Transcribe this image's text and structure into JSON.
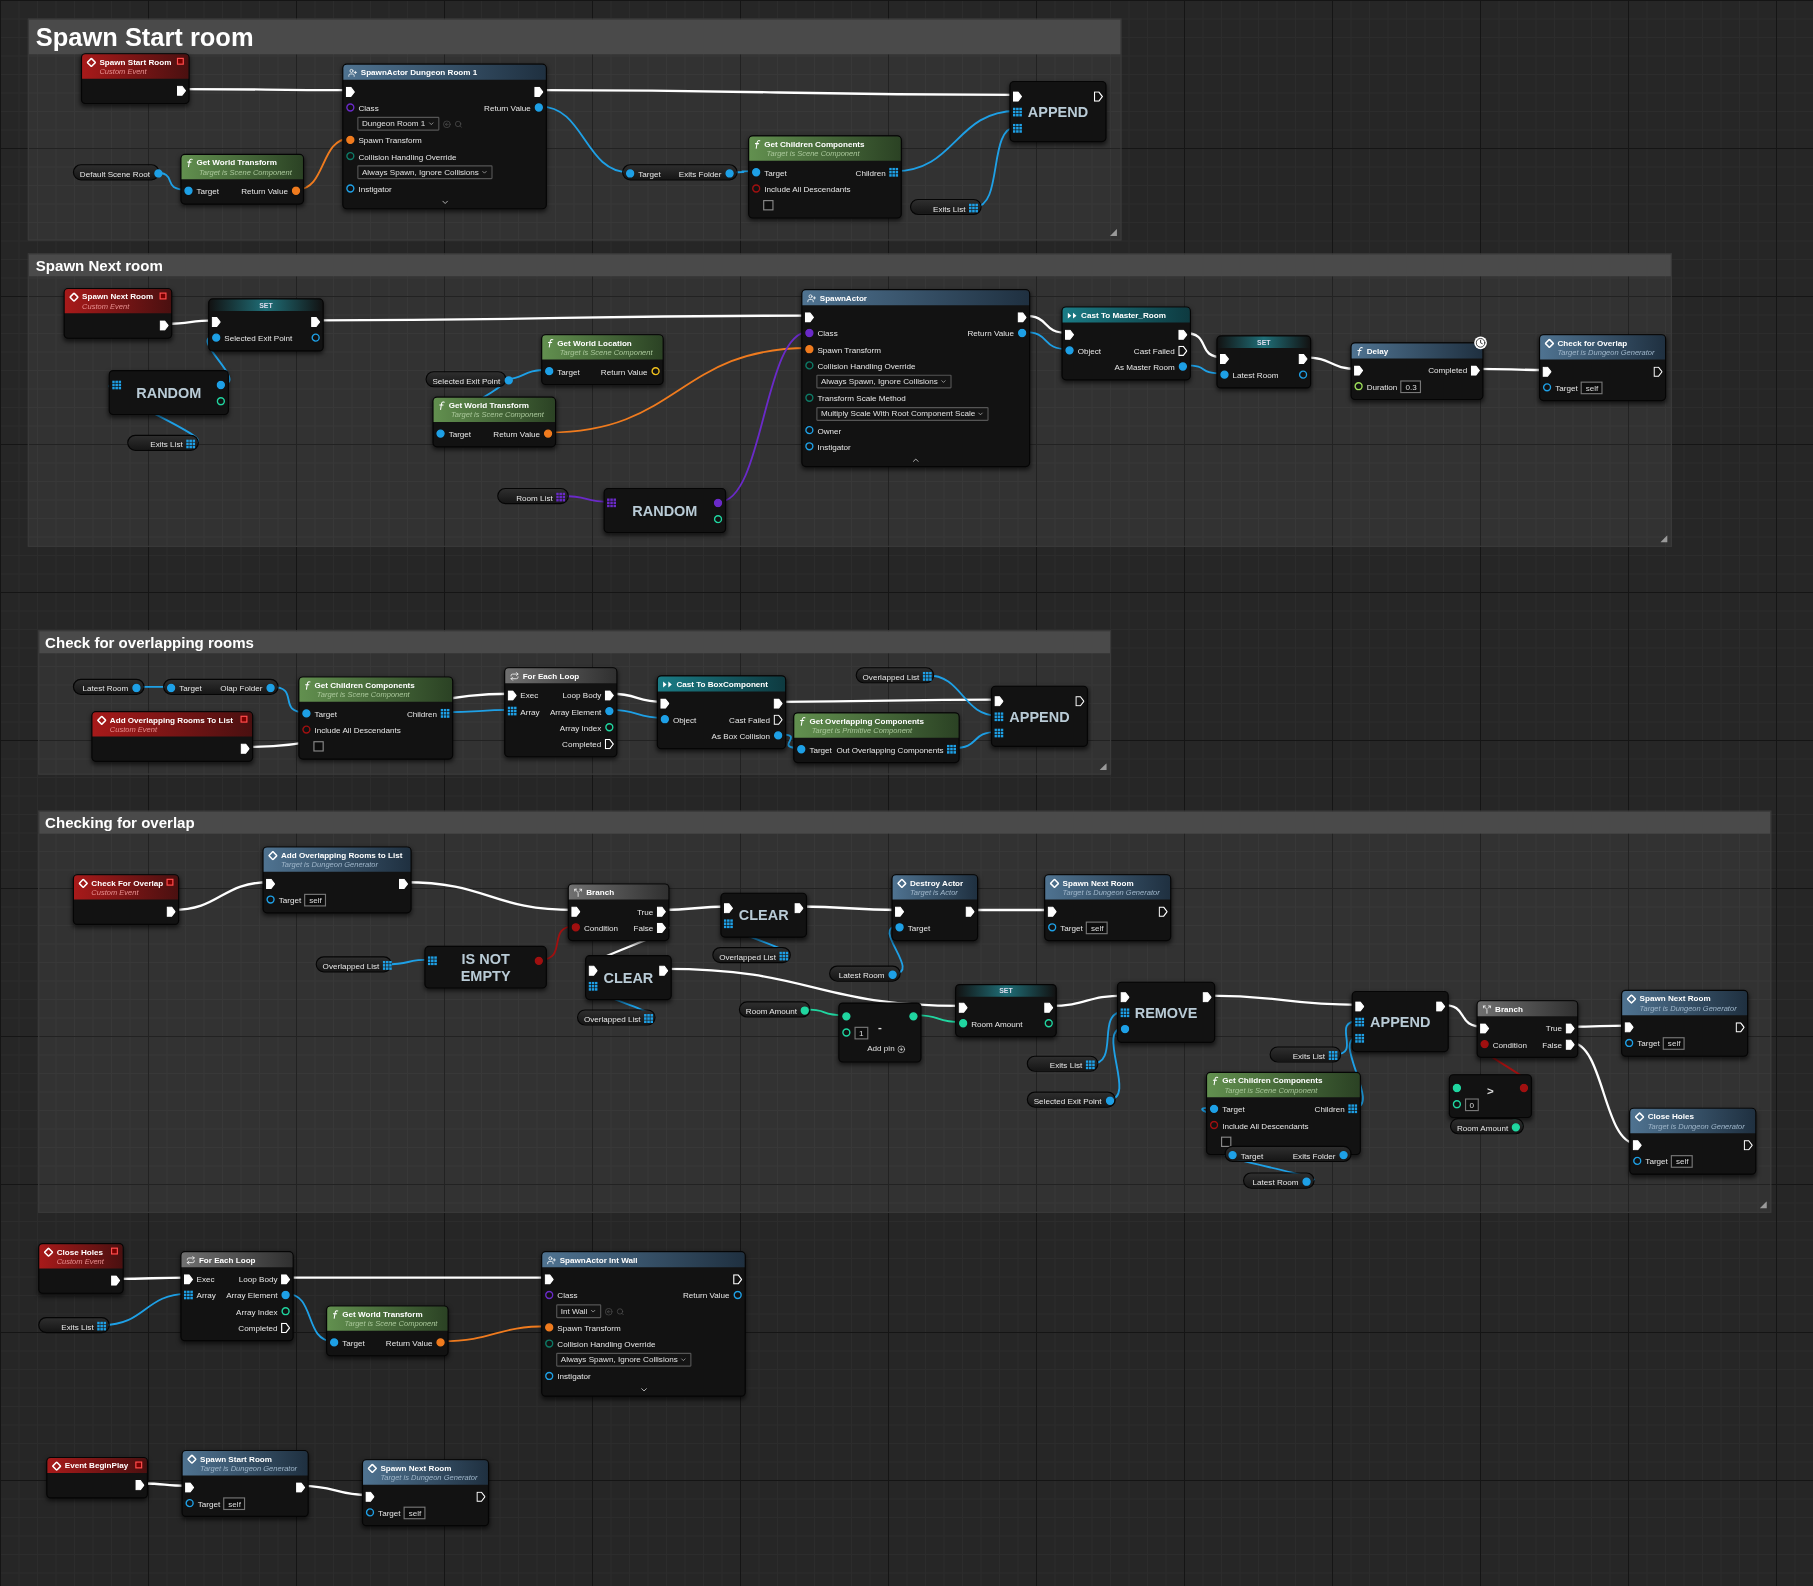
{
  "comments": [
    {
      "title": "Spawn Start room",
      "nodes": [
        {
          "kind": "event",
          "title": "Spawn Start Room",
          "subtitle": "Custom Event",
          "rows": [
            {
              "out": {
                "kind": "exec",
                "linked": true
              }
            }
          ]
        },
        {
          "kind": "spawn",
          "title": "SpawnActor Dungeon Room 1",
          "expanded": false,
          "rows": [
            {
              "in": {
                "kind": "exec",
                "linked": true
              },
              "out": {
                "kind": "exec",
                "linked": true
              }
            },
            {
              "in": {
                "kind": "class",
                "label": "Class",
                "linked": false
              },
              "out": {
                "kind": "object",
                "label": "Return Value",
                "linked": true
              }
            },
            {
              "dropdown": {
                "kind": "class",
                "text": "Dungeon Room 1"
              }
            },
            {
              "in": {
                "kind": "transform",
                "label": "Spawn Transform",
                "linked": true
              }
            },
            {
              "in": {
                "kind": "enum",
                "label": "Collision Handling Override",
                "linked": false
              }
            },
            {
              "dropdown": {
                "kind": "enum",
                "text": "Always Spawn, Ignore Collisions"
              }
            },
            {
              "in": {
                "kind": "object",
                "label": "Instigator",
                "linked": false
              }
            }
          ]
        },
        {
          "kind": "variable",
          "rows": [
            {
              "out": {
                "kind": "object",
                "label": "Default Scene Root",
                "linked": true
              }
            }
          ]
        },
        {
          "kind": "pure",
          "title": "Get World Transform",
          "subtitle": "Target is Scene Component",
          "rows": [
            {
              "in": {
                "kind": "object",
                "label": "Target",
                "linked": true
              },
              "out": {
                "kind": "transform",
                "label": "Return Value",
                "linked": true
              }
            }
          ]
        },
        {
          "kind": "getter",
          "rows": [
            {
              "in": {
                "kind": "object",
                "label": "Target",
                "linked": true
              },
              "out": {
                "kind": "object",
                "label": "Exits Folder",
                "linked": true
              }
            }
          ]
        },
        {
          "kind": "pure",
          "title": "Get Children Components",
          "subtitle": "Target is Scene Component",
          "rows": [
            {
              "in": {
                "kind": "object",
                "label": "Target",
                "linked": true
              },
              "out": {
                "kind": "object_array",
                "label": "Children",
                "linked": true
              }
            },
            {
              "in": {
                "kind": "bool",
                "label": "Include All Descendants",
                "linked": false
              }
            },
            {
              "checkbox": {
                "checked": false
              }
            }
          ]
        },
        {
          "kind": "variable",
          "rows": [
            {
              "out": {
                "kind": "object_array",
                "label": "Exits List",
                "linked": true
              }
            }
          ]
        },
        {
          "kind": "macro",
          "title": "APPEND",
          "rows": [
            {
              "in": {
                "kind": "exec",
                "linked": true
              },
              "out": {
                "kind": "exec",
                "linked": false
              }
            },
            {
              "in": {
                "kind": "object_array",
                "linked": true
              }
            },
            {
              "in": {
                "kind": "object_array",
                "linked": true
              }
            }
          ]
        }
      ]
    },
    {
      "title": "Spawn Next room",
      "nodes": [
        {
          "kind": "event",
          "title": "Spawn Next Room",
          "subtitle": "Custom Event",
          "rows": [
            {
              "out": {
                "kind": "exec",
                "linked": true
              }
            }
          ]
        },
        {
          "kind": "set",
          "title": "SET",
          "rows": [
            {
              "in": {
                "kind": "exec",
                "linked": true
              },
              "out": {
                "kind": "exec",
                "linked": true
              }
            },
            {
              "in": {
                "kind": "object",
                "label": "Selected Exit Point",
                "linked": true
              },
              "out": {
                "kind": "object",
                "linked": false
              }
            }
          ]
        },
        {
          "kind": "macro",
          "title": "RANDOM",
          "rows": [
            {
              "in": {
                "kind": "object_array",
                "linked": true
              },
              "out": {
                "kind": "object",
                "linked": true
              }
            },
            {
              "out": {
                "kind": "int",
                "linked": false
              }
            }
          ]
        },
        {
          "kind": "variable",
          "rows": [
            {
              "out": {
                "kind": "object_array",
                "label": "Exits List",
                "linked": true
              }
            }
          ]
        },
        {
          "kind": "pure",
          "title": "Get World Location",
          "subtitle": "Target is Scene Component",
          "rows": [
            {
              "in": {
                "kind": "object",
                "label": "Target",
                "linked": true
              },
              "out": {
                "kind": "vector",
                "label": "Return Value",
                "linked": false
              }
            }
          ]
        },
        {
          "kind": "variable",
          "rows": [
            {
              "out": {
                "kind": "object",
                "label": "Selected Exit Point",
                "linked": true
              }
            }
          ]
        },
        {
          "kind": "pure",
          "title": "Get World Transform",
          "subtitle": "Target is Scene Component",
          "rows": [
            {
              "in": {
                "kind": "object",
                "label": "Target",
                "linked": true
              },
              "out": {
                "kind": "transform",
                "label": "Return Value",
                "linked": true
              }
            }
          ]
        },
        {
          "kind": "variable",
          "rows": [
            {
              "out": {
                "kind": "class_array",
                "label": "Room List",
                "linked": true
              }
            }
          ]
        },
        {
          "kind": "macro",
          "title": "RANDOM",
          "rows": [
            {
              "in": {
                "kind": "class_array",
                "linked": true
              },
              "out": {
                "kind": "class",
                "linked": true
              }
            },
            {
              "out": {
                "kind": "int",
                "linked": false
              }
            }
          ]
        },
        {
          "kind": "spawn",
          "title": "SpawnActor",
          "expanded": true,
          "rows": [
            {
              "in": {
                "kind": "exec",
                "linked": true
              },
              "out": {
                "kind": "exec",
                "linked": true
              }
            },
            {
              "in": {
                "kind": "class",
                "label": "Class",
                "linked": true
              },
              "out": {
                "kind": "object",
                "label": "Return Value",
                "linked": true
              }
            },
            {
              "in": {
                "kind": "transform",
                "label": "Spawn Transform",
                "linked": true
              }
            },
            {
              "in": {
                "kind": "enum",
                "label": "Collision Handling Override",
                "linked": false
              }
            },
            {
              "dropdown": {
                "kind": "enum",
                "text": "Always Spawn, Ignore Collisions"
              }
            },
            {
              "in": {
                "kind": "enum",
                "label": "Transform Scale Method",
                "linked": false
              }
            },
            {
              "dropdown": {
                "kind": "enum",
                "text": "Multiply Scale With Root Component Scale"
              }
            },
            {
              "in": {
                "kind": "object",
                "label": "Owner",
                "linked": false
              }
            },
            {
              "in": {
                "kind": "object",
                "label": "Instigator",
                "linked": false
              }
            }
          ]
        },
        {
          "kind": "cast",
          "title": "Cast To Master_Room",
          "rows": [
            {
              "in": {
                "kind": "exec",
                "linked": true
              },
              "out": {
                "kind": "exec",
                "linked": true
              }
            },
            {
              "in": {
                "kind": "object",
                "label": "Object",
                "linked": true
              },
              "out": {
                "kind": "exec",
                "label": "Cast Failed",
                "linked": false
              }
            },
            {
              "out": {
                "kind": "object",
                "label": "As Master Room",
                "linked": true
              }
            }
          ]
        },
        {
          "kind": "set",
          "title": "SET",
          "rows": [
            {
              "in": {
                "kind": "exec",
                "linked": true
              },
              "out": {
                "kind": "exec",
                "linked": true
              }
            },
            {
              "in": {
                "kind": "object",
                "label": "Latest Room",
                "linked": true
              },
              "out": {
                "kind": "object",
                "linked": false
              }
            }
          ]
        },
        {
          "kind": "latent",
          "title": "Delay",
          "rows": [
            {
              "in": {
                "kind": "exec",
                "linked": true
              },
              "out": {
                "kind": "exec",
                "label": "Completed",
                "linked": true
              }
            },
            {
              "in": {
                "kind": "float",
                "label": "Duration",
                "linked": false
              },
              "value": "0.3"
            }
          ]
        },
        {
          "kind": "call",
          "title": "Check for Overlap",
          "subtitle": "Target is Dungeon Generator",
          "rows": [
            {
              "in": {
                "kind": "exec",
                "linked": true
              },
              "out": {
                "kind": "exec",
                "linked": false
              }
            },
            {
              "in": {
                "kind": "object",
                "label": "Target",
                "linked": false
              },
              "value": "self"
            }
          ]
        }
      ]
    },
    {
      "title": "Check for overlapping rooms",
      "nodes": [
        {
          "kind": "variable",
          "rows": [
            {
              "out": {
                "kind": "object",
                "label": "Latest Room",
                "linked": true
              }
            }
          ]
        },
        {
          "kind": "getter",
          "rows": [
            {
              "in": {
                "kind": "object",
                "label": "Target",
                "linked": true
              },
              "out": {
                "kind": "object",
                "label": "Olap Folder",
                "linked": true
              }
            }
          ]
        },
        {
          "kind": "event",
          "title": "Add Overlapping Rooms To List",
          "subtitle": "Custom Event",
          "rows": [
            {
              "out": {
                "kind": "exec",
                "linked": true
              }
            }
          ]
        },
        {
          "kind": "pure",
          "title": "Get Children Components",
          "subtitle": "Target is Scene Component",
          "rows": [
            {
              "in": {
                "kind": "object",
                "label": "Target",
                "linked": true
              },
              "out": {
                "kind": "object_array",
                "label": "Children",
                "linked": true
              }
            },
            {
              "in": {
                "kind": "bool",
                "label": "Include All Descendants",
                "linked": false
              }
            },
            {
              "checkbox": {
                "checked": false
              }
            }
          ]
        },
        {
          "kind": "loop",
          "title": "For Each Loop",
          "rows": [
            {
              "in": {
                "kind": "exec",
                "label": "Exec",
                "linked": true
              },
              "out": {
                "kind": "exec",
                "label": "Loop Body",
                "linked": true
              }
            },
            {
              "in": {
                "kind": "object_array",
                "label": "Array",
                "linked": true
              },
              "out": {
                "kind": "object",
                "label": "Array Element",
                "linked": true
              }
            },
            {
              "out": {
                "kind": "int",
                "label": "Array Index",
                "linked": false
              }
            },
            {
              "out": {
                "kind": "exec",
                "label": "Completed",
                "linked": false
              }
            }
          ]
        },
        {
          "kind": "cast",
          "title": "Cast To BoxComponent",
          "rows": [
            {
              "in": {
                "kind": "exec",
                "linked": true
              },
              "out": {
                "kind": "exec",
                "linked": true
              }
            },
            {
              "in": {
                "kind": "object",
                "label": "Object",
                "linked": true
              },
              "out": {
                "kind": "exec",
                "label": "Cast Failed",
                "linked": false
              }
            },
            {
              "out": {
                "kind": "object",
                "label": "As Box Collision",
                "linked": true
              }
            }
          ]
        },
        {
          "kind": "variable",
          "rows": [
            {
              "out": {
                "kind": "object_array",
                "label": "Overlapped List",
                "linked": true
              }
            }
          ]
        },
        {
          "kind": "pure",
          "title": "Get Overlapping Components",
          "subtitle": "Target is Primitive Component",
          "rows": [
            {
              "in": {
                "kind": "object",
                "label": "Target",
                "linked": true
              },
              "out": {
                "kind": "object_array",
                "label": "Out Overlapping Components",
                "linked": true
              }
            }
          ]
        },
        {
          "kind": "macro",
          "title": "APPEND",
          "rows": [
            {
              "in": {
                "kind": "exec",
                "linked": true
              },
              "out": {
                "kind": "exec",
                "linked": false
              }
            },
            {
              "in": {
                "kind": "object_array",
                "linked": true
              }
            },
            {
              "in": {
                "kind": "object_array",
                "linked": true
              }
            }
          ]
        }
      ]
    },
    {
      "title": "Checking for overlap",
      "nodes": [
        {
          "kind": "event",
          "title": "Check For Overlap",
          "subtitle": "Custom Event",
          "rows": [
            {
              "out": {
                "kind": "exec",
                "linked": true
              }
            }
          ]
        },
        {
          "kind": "call",
          "title": "Add Overlapping Rooms to List",
          "subtitle": "Target is Dungeon Generator",
          "rows": [
            {
              "in": {
                "kind": "exec",
                "linked": true
              },
              "out": {
                "kind": "exec",
                "linked": true
              }
            },
            {
              "in": {
                "kind": "object",
                "label": "Target",
                "linked": false
              },
              "value": "self"
            }
          ]
        },
        {
          "kind": "branch",
          "title": "Branch",
          "rows": [
            {
              "in": {
                "kind": "exec",
                "linked": true
              },
              "out": {
                "kind": "exec",
                "label": "True",
                "linked": true
              }
            },
            {
              "in": {
                "kind": "bool",
                "label": "Condition",
                "linked": true
              },
              "out": {
                "kind": "exec",
                "label": "False",
                "linked": true
              }
            }
          ]
        },
        {
          "kind": "variable",
          "rows": [
            {
              "out": {
                "kind": "object_array",
                "label": "Overlapped List",
                "linked": true
              }
            }
          ]
        },
        {
          "kind": "macro",
          "title": "IS NOT EMPTY",
          "rows": [
            {
              "in": {
                "kind": "object_array",
                "linked": true
              },
              "out": {
                "kind": "bool",
                "linked": true
              }
            }
          ]
        },
        {
          "kind": "macro",
          "title": "CLEAR",
          "rows": [
            {
              "in": {
                "kind": "exec",
                "linked": true
              },
              "out": {
                "kind": "exec",
                "linked": true
              }
            },
            {
              "in": {
                "kind": "object_array",
                "linked": true
              }
            }
          ]
        },
        {
          "kind": "variable",
          "rows": [
            {
              "out": {
                "kind": "object_array",
                "label": "Overlapped List",
                "linked": true
              }
            }
          ]
        },
        {
          "kind": "macro",
          "title": "CLEAR",
          "rows": [
            {
              "in": {
                "kind": "exec",
                "linked": true
              },
              "out": {
                "kind": "exec",
                "linked": true
              }
            },
            {
              "in": {
                "kind": "object_array",
                "linked": true
              }
            }
          ]
        },
        {
          "kind": "variable",
          "rows": [
            {
              "out": {
                "kind": "object_array",
                "label": "Overlapped List",
                "linked": true
              }
            }
          ]
        },
        {
          "kind": "call",
          "title": "Destroy Actor",
          "subtitle": "Target is Actor",
          "rows": [
            {
              "in": {
                "kind": "exec",
                "linked": true
              },
              "out": {
                "kind": "exec",
                "linked": true
              }
            },
            {
              "in": {
                "kind": "object",
                "label": "Target",
                "linked": true
              }
            }
          ]
        },
        {
          "kind": "variable",
          "rows": [
            {
              "out": {
                "kind": "object",
                "label": "Latest Room",
                "linked": true
              }
            }
          ]
        },
        {
          "kind": "call",
          "title": "Spawn Next Room",
          "subtitle": "Target is Dungeon Generator",
          "rows": [
            {
              "in": {
                "kind": "exec",
                "linked": true
              },
              "out": {
                "kind": "exec",
                "linked": false
              }
            },
            {
              "in": {
                "kind": "object",
                "label": "Target",
                "linked": false
              },
              "value": "self"
            }
          ]
        },
        {
          "kind": "variable",
          "rows": [
            {
              "out": {
                "kind": "int",
                "label": "Room Amount",
                "linked": true
              }
            }
          ]
        },
        {
          "kind": "operator",
          "title": "-",
          "rows": [
            {
              "in": {
                "kind": "int",
                "linked": true
              },
              "out": {
                "kind": "int",
                "linked": true
              }
            },
            {
              "in": {
                "kind": "int",
                "linked": false
              },
              "value": "1"
            },
            {
              "note": "Add pin"
            }
          ]
        },
        {
          "kind": "set",
          "title": "SET",
          "rows": [
            {
              "in": {
                "kind": "exec",
                "linked": true
              },
              "out": {
                "kind": "exec",
                "linked": true
              }
            },
            {
              "in": {
                "kind": "int",
                "label": "Room Amount",
                "linked": true
              },
              "out": {
                "kind": "int",
                "linked": false
              }
            }
          ]
        },
        {
          "kind": "macro",
          "title": "REMOVE",
          "rows": [
            {
              "in": {
                "kind": "exec",
                "linked": true
              },
              "out": {
                "kind": "exec",
                "linked": true
              }
            },
            {
              "in": {
                "kind": "object_array",
                "linked": true
              }
            },
            {
              "in": {
                "kind": "object",
                "linked": true
              }
            }
          ]
        },
        {
          "kind": "variable",
          "rows": [
            {
              "out": {
                "kind": "object_array",
                "label": "Exits List",
                "linked": true
              }
            }
          ]
        },
        {
          "kind": "variable",
          "rows": [
            {
              "out": {
                "kind": "object",
                "label": "Selected Exit Point",
                "linked": true
              }
            }
          ]
        },
        {
          "kind": "macro",
          "title": "APPEND",
          "rows": [
            {
              "in": {
                "kind": "exec",
                "linked": true
              },
              "out": {
                "kind": "exec",
                "linked": true
              }
            },
            {
              "in": {
                "kind": "object_array",
                "linked": true
              }
            },
            {
              "in": {
                "kind": "object_array",
                "linked": true
              }
            }
          ]
        },
        {
          "kind": "variable",
          "rows": [
            {
              "out": {
                "kind": "object_array",
                "label": "Exits List",
                "linked": true
              }
            }
          ]
        },
        {
          "kind": "pure",
          "title": "Get Children Components",
          "subtitle": "Target is Scene Component",
          "rows": [
            {
              "in": {
                "kind": "object",
                "label": "Target",
                "linked": true
              },
              "out": {
                "kind": "object_array",
                "label": "Children",
                "linked": true
              }
            },
            {
              "in": {
                "kind": "bool",
                "label": "Include All Descendants",
                "linked": false
              }
            },
            {
              "checkbox": {
                "checked": false
              }
            }
          ]
        },
        {
          "kind": "getter",
          "rows": [
            {
              "in": {
                "kind": "object",
                "label": "Target",
                "linked": true
              },
              "out": {
                "kind": "object",
                "label": "Exits Folder",
                "linked": true
              }
            }
          ]
        },
        {
          "kind": "variable",
          "rows": [
            {
              "out": {
                "kind": "object",
                "label": "Latest Room",
                "linked": true
              }
            }
          ]
        },
        {
          "kind": "branch",
          "title": "Branch",
          "rows": [
            {
              "in": {
                "kind": "exec",
                "linked": true
              },
              "out": {
                "kind": "exec",
                "label": "True",
                "linked": true
              }
            },
            {
              "in": {
                "kind": "bool",
                "label": "Condition",
                "linked": true
              },
              "out": {
                "kind": "exec",
                "label": "False",
                "linked": true
              }
            }
          ]
        },
        {
          "kind": "operator",
          "title": ">",
          "rows": [
            {
              "in": {
                "kind": "int",
                "linked": true
              },
              "out": {
                "kind": "bool",
                "linked": true
              }
            },
            {
              "in": {
                "kind": "int",
                "linked": false
              },
              "value": "0"
            }
          ]
        },
        {
          "kind": "variable",
          "rows": [
            {
              "out": {
                "kind": "int",
                "label": "Room Amount",
                "linked": true
              }
            }
          ]
        },
        {
          "kind": "call",
          "title": "Spawn Next Room",
          "subtitle": "Target is Dungeon Generator",
          "rows": [
            {
              "in": {
                "kind": "exec",
                "linked": true
              },
              "out": {
                "kind": "exec",
                "linked": false
              }
            },
            {
              "in": {
                "kind": "object",
                "label": "Target",
                "linked": false
              },
              "value": "self"
            }
          ]
        },
        {
          "kind": "call",
          "title": "Close Holes",
          "subtitle": "Target is Dungeon Generator",
          "rows": [
            {
              "in": {
                "kind": "exec",
                "linked": true
              },
              "out": {
                "kind": "exec",
                "linked": false
              }
            },
            {
              "in": {
                "kind": "object",
                "label": "Target",
                "linked": false
              },
              "value": "self"
            }
          ]
        }
      ]
    }
  ],
  "free_nodes": [
    {
      "kind": "event",
      "title": "Close Holes",
      "subtitle": "Custom Event",
      "rows": [
        {
          "out": {
            "kind": "exec",
            "linked": true
          }
        }
      ]
    },
    {
      "kind": "variable",
      "rows": [
        {
          "out": {
            "kind": "object_array",
            "label": "Exits List",
            "linked": true
          }
        }
      ]
    },
    {
      "kind": "loop",
      "title": "For Each Loop",
      "rows": [
        {
          "in": {
            "kind": "exec",
            "label": "Exec",
            "linked": true
          },
          "out": {
            "kind": "exec",
            "label": "Loop Body",
            "linked": true
          }
        },
        {
          "in": {
            "kind": "object_array",
            "label": "Array",
            "linked": true
          },
          "out": {
            "kind": "object",
            "label": "Array Element",
            "linked": true
          }
        },
        {
          "out": {
            "kind": "int",
            "label": "Array Index",
            "linked": false
          }
        },
        {
          "out": {
            "kind": "exec",
            "label": "Completed",
            "linked": false
          }
        }
      ]
    },
    {
      "kind": "pure",
      "title": "Get World Transform",
      "subtitle": "Target is Scene Component",
      "rows": [
        {
          "in": {
            "kind": "object",
            "label": "Target",
            "linked": true
          },
          "out": {
            "kind": "transform",
            "label": "Return Value",
            "linked": true
          }
        }
      ]
    },
    {
      "kind": "spawn",
      "title": "SpawnActor Int Wall",
      "expanded": false,
      "rows": [
        {
          "in": {
            "kind": "exec",
            "linked": true
          },
          "out": {
            "kind": "exec",
            "linked": false
          }
        },
        {
          "in": {
            "kind": "class",
            "label": "Class",
            "linked": false
          },
          "out": {
            "kind": "object",
            "label": "Return Value",
            "linked": false
          }
        },
        {
          "dropdown": {
            "kind": "class",
            "text": "Int Wall"
          }
        },
        {
          "in": {
            "kind": "transform",
            "label": "Spawn Transform",
            "linked": true
          }
        },
        {
          "in": {
            "kind": "enum",
            "label": "Collision Handling Override",
            "linked": false
          }
        },
        {
          "dropdown": {
            "kind": "enum",
            "text": "Always Spawn, Ignore Collisions"
          }
        },
        {
          "in": {
            "kind": "object",
            "label": "Instigator",
            "linked": false
          }
        }
      ]
    },
    {
      "kind": "event",
      "title": "Event BeginPlay",
      "rows": [
        {
          "out": {
            "kind": "exec",
            "linked": true
          }
        }
      ]
    },
    {
      "kind": "call",
      "title": "Spawn Start Room",
      "subtitle": "Target is Dungeon Generator",
      "rows": [
        {
          "in": {
            "kind": "exec",
            "linked": true
          },
          "out": {
            "kind": "exec",
            "linked": true
          }
        },
        {
          "in": {
            "kind": "object",
            "label": "Target",
            "linked": false
          },
          "value": "self"
        }
      ]
    },
    {
      "kind": "call",
      "title": "Spawn Next Room",
      "subtitle": "Target is Dungeon Generator",
      "rows": [
        {
          "in": {
            "kind": "exec",
            "linked": true
          },
          "out": {
            "kind": "exec",
            "linked": false
          }
        },
        {
          "in": {
            "kind": "object",
            "label": "Target",
            "linked": false
          },
          "value": "self"
        }
      ]
    }
  ]
}
